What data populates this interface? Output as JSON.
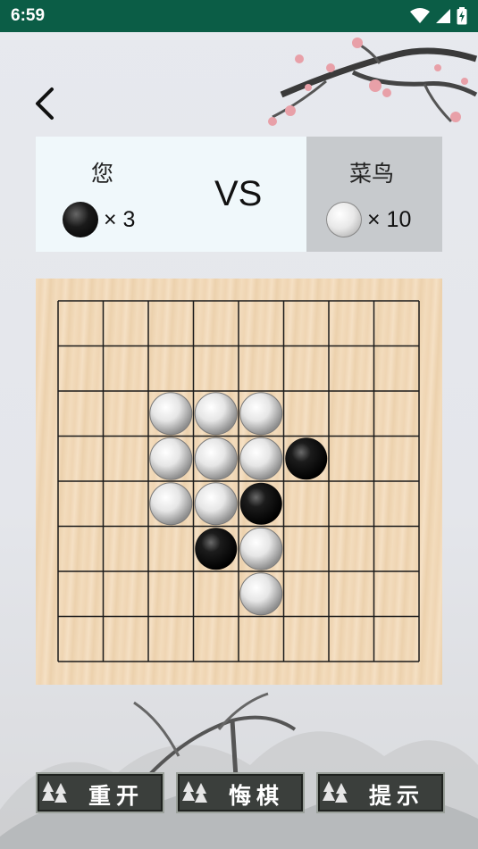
{
  "status_bar": {
    "time": "6:59",
    "icons": [
      "wifi-icon",
      "signal-icon",
      "battery-charging-icon"
    ]
  },
  "nav": {
    "back_icon": "chevron-left-icon"
  },
  "score": {
    "player_name": "您",
    "player_stone": "black",
    "player_count": "× 3",
    "vs": "VS",
    "ai_name": "菜鸟",
    "ai_stone": "white",
    "ai_count": "× 10"
  },
  "board": {
    "size": 8,
    "stones": [
      {
        "row": 2,
        "col": 2,
        "color": "white"
      },
      {
        "row": 2,
        "col": 3,
        "color": "white"
      },
      {
        "row": 2,
        "col": 4,
        "color": "white"
      },
      {
        "row": 3,
        "col": 2,
        "color": "white"
      },
      {
        "row": 3,
        "col": 3,
        "color": "white"
      },
      {
        "row": 3,
        "col": 4,
        "color": "white"
      },
      {
        "row": 3,
        "col": 5,
        "color": "black"
      },
      {
        "row": 4,
        "col": 2,
        "color": "white"
      },
      {
        "row": 4,
        "col": 3,
        "color": "white"
      },
      {
        "row": 4,
        "col": 4,
        "color": "black"
      },
      {
        "row": 5,
        "col": 3,
        "color": "black"
      },
      {
        "row": 5,
        "col": 4,
        "color": "white"
      },
      {
        "row": 6,
        "col": 4,
        "color": "white"
      }
    ]
  },
  "actions": [
    {
      "label": "重开",
      "icon": "pine-tree-icon"
    },
    {
      "label": "悔棋",
      "icon": "pine-tree-icon"
    },
    {
      "label": "提示",
      "icon": "pine-tree-icon"
    }
  ],
  "colors": {
    "status_bar": "#0b5d46",
    "player_panel": "#f0f8fb",
    "ai_panel": "#c7cacd",
    "button": "#3b3f3c"
  }
}
